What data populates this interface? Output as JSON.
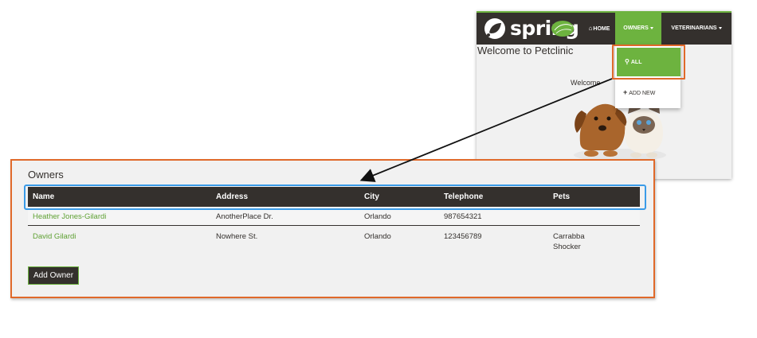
{
  "header": {
    "logo_text": "spring",
    "nav": {
      "home_label": "HOME",
      "owners_label": "OWNERS",
      "veterinarians_label": "VETERINARIANS"
    }
  },
  "dropdown": {
    "all_label": "ALL",
    "add_new_label": "ADD NEW"
  },
  "home": {
    "title": "Welcome to Petclinic",
    "subtitle": "Welcome"
  },
  "owners": {
    "title": "Owners",
    "columns": [
      "Name",
      "Address",
      "City",
      "Telephone",
      "Pets"
    ],
    "rows": [
      {
        "name": "Heather Jones-Gilardi",
        "address": "AnotherPlace Dr.",
        "city": "Orlando",
        "telephone": "987654321",
        "pets": [
          "",
          ""
        ]
      },
      {
        "name": "David Gilardi",
        "address": "Nowhere St.",
        "city": "Orlando",
        "telephone": "123456789",
        "pets": [
          "Carrabba",
          "Shocker"
        ]
      }
    ],
    "add_owner_label": "Add Owner"
  },
  "colors": {
    "brand_green": "#6db33f",
    "dark": "#34302d",
    "highlight_orange": "#e0692a",
    "highlight_blue": "#3a9be8"
  }
}
